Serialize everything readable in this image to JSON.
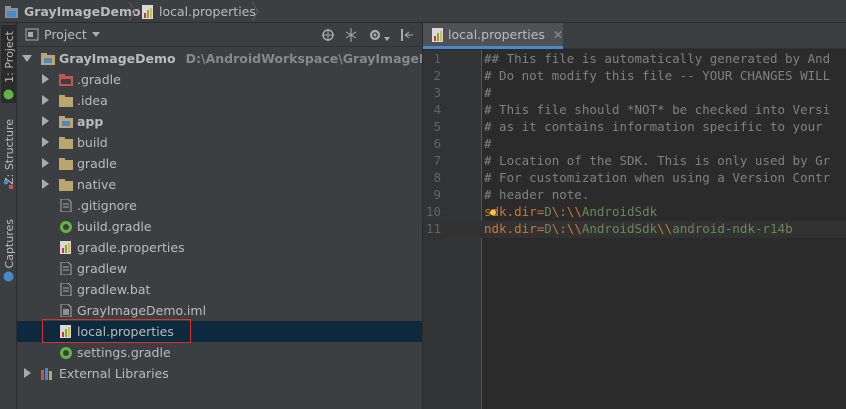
{
  "breadcrumb": {
    "project": "GrayImageDemo",
    "file": "local.properties"
  },
  "side_tabs": [
    {
      "label": "1: Project"
    },
    {
      "label": "Z: Structure"
    },
    {
      "label": "Captures"
    }
  ],
  "project_panel": {
    "view_selector": "Project",
    "tree": [
      {
        "label": "GrayImageDemo",
        "hint": "D:\\AndroidWorkspace\\GrayImageDemo",
        "bold": true,
        "icon": "module-folder-icon",
        "expand": "down"
      },
      {
        "label": ".gradle",
        "icon": "excluded-folder-icon",
        "expand": "right"
      },
      {
        "label": ".idea",
        "icon": "folder-icon",
        "expand": "right"
      },
      {
        "label": "app",
        "bold": true,
        "icon": "module-folder-icon",
        "expand": "right"
      },
      {
        "label": "build",
        "icon": "folder-icon",
        "expand": "right"
      },
      {
        "label": "gradle",
        "icon": "folder-icon",
        "expand": "right"
      },
      {
        "label": "native",
        "icon": "folder-icon",
        "expand": "right"
      },
      {
        "label": ".gitignore",
        "icon": "file-icon"
      },
      {
        "label": "build.gradle",
        "icon": "gradle-file-icon"
      },
      {
        "label": "gradle.properties",
        "icon": "properties-file-icon"
      },
      {
        "label": "gradlew",
        "icon": "file-icon"
      },
      {
        "label": "gradlew.bat",
        "icon": "file-icon"
      },
      {
        "label": "GrayImageDemo.iml",
        "icon": "iml-file-icon"
      },
      {
        "label": "local.properties",
        "icon": "properties-file-icon",
        "selected": true
      },
      {
        "label": "settings.gradle",
        "icon": "gradle-file-icon"
      },
      {
        "label": "External Libraries",
        "icon": "libraries-icon",
        "expand": "right"
      }
    ]
  },
  "editor": {
    "tab_label": "local.properties",
    "lines": [
      {
        "num": "1",
        "parts": [
          {
            "t": "## This file is automatically generated by And",
            "c": "c-comment"
          }
        ]
      },
      {
        "num": "2",
        "parts": [
          {
            "t": "# Do not modify this file -- YOUR CHANGES WILL",
            "c": "c-comment"
          }
        ]
      },
      {
        "num": "3",
        "parts": [
          {
            "t": "#",
            "c": "c-comment"
          }
        ]
      },
      {
        "num": "4",
        "parts": [
          {
            "t": "# This file should *NOT* be checked into Versi",
            "c": "c-comment"
          }
        ]
      },
      {
        "num": "5",
        "parts": [
          {
            "t": "# as it contains information specific to your",
            "c": "c-comment"
          }
        ]
      },
      {
        "num": "6",
        "parts": [
          {
            "t": "#",
            "c": "c-comment"
          }
        ]
      },
      {
        "num": "7",
        "parts": [
          {
            "t": "# Location of the SDK. This is only used by Gr",
            "c": "c-comment"
          }
        ]
      },
      {
        "num": "8",
        "parts": [
          {
            "t": "# For customization when using a Version Contr",
            "c": "c-comment"
          }
        ]
      },
      {
        "num": "9",
        "parts": [
          {
            "t": "# header note.",
            "c": "c-comment"
          }
        ]
      },
      {
        "num": "10",
        "parts": [
          {
            "t": "sdk.dir",
            "c": "c-key"
          },
          {
            "t": "=",
            "c": "c-eq"
          },
          {
            "t": "D",
            "c": "c-val"
          },
          {
            "t": "\\:\\\\",
            "c": "c-esc"
          },
          {
            "t": "AndroidSdk",
            "c": "c-val"
          }
        ]
      },
      {
        "num": "11",
        "current": true,
        "parts": [
          {
            "t": "ndk.dir",
            "c": "c-key"
          },
          {
            "t": "=",
            "c": "c-eq"
          },
          {
            "t": "D",
            "c": "c-val"
          },
          {
            "t": "\\:\\\\",
            "c": "c-esc"
          },
          {
            "t": "AndroidSdk",
            "c": "c-val"
          },
          {
            "t": "\\\\",
            "c": "c-esc"
          },
          {
            "t": "android-ndk-r14b",
            "c": "c-val"
          }
        ]
      }
    ]
  },
  "colors": {
    "background": "#2b2b2b",
    "panel": "#3c3f41",
    "selection": "#0d293e",
    "highlight_box": "#e0302e",
    "tab_underline": "#4a88c7"
  }
}
